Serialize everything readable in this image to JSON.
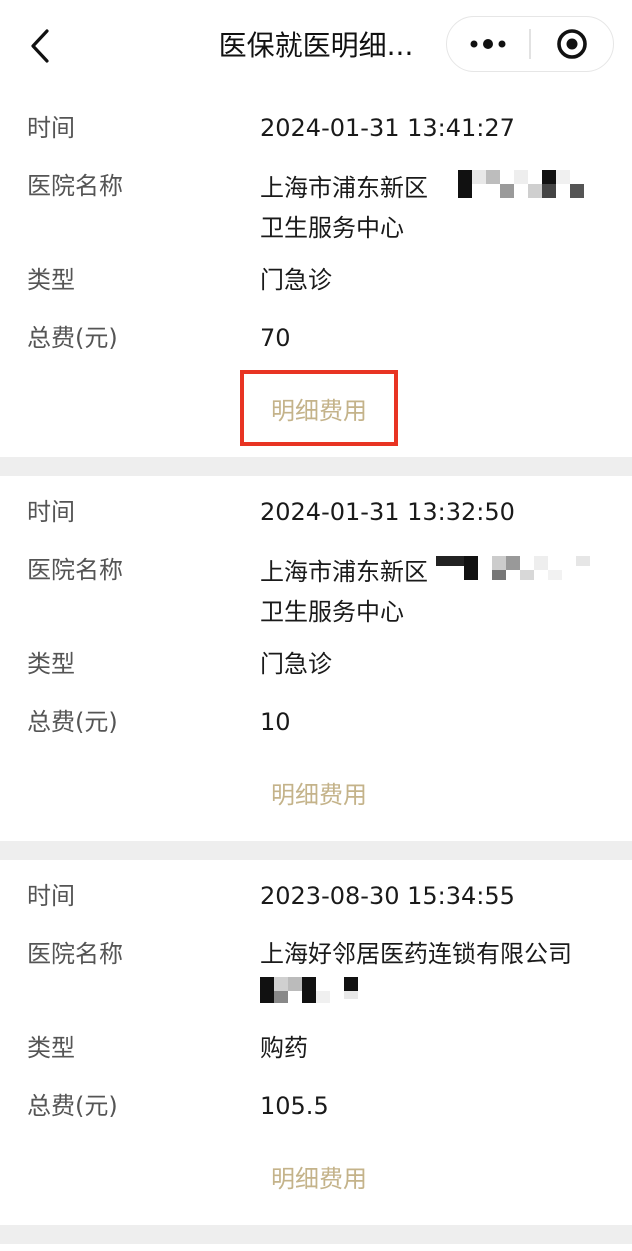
{
  "header": {
    "title": "医保就医明细...",
    "back_icon": "chevron-left-icon",
    "more_icon": "more-dots-icon",
    "close_icon": "target-circle-icon"
  },
  "labels": {
    "time": "时间",
    "hospital": "医院名称",
    "type": "类型",
    "total": "总费(元)"
  },
  "records": [
    {
      "time": "2024-01-31 13:41:27",
      "hospital_line1": "上海市浦东新区",
      "hospital_line2": "卫生服务中心",
      "type": "门急诊",
      "total": "70",
      "detail_label": "明细费用",
      "highlighted": true
    },
    {
      "time": "2024-01-31 13:32:50",
      "hospital_line1": "上海市浦东新区",
      "hospital_line2": "卫生服务中心",
      "type": "门急诊",
      "total": "10",
      "detail_label": "明细费用",
      "highlighted": false
    },
    {
      "time": "2023-08-30 15:34:55",
      "hospital_line1": "上海好邻居医药连锁有限公司",
      "hospital_line2": "",
      "type": "购药",
      "total": "105.5",
      "detail_label": "明细费用",
      "highlighted": false
    }
  ],
  "colors": {
    "accent_text": "#c4b38a",
    "highlight_border": "#e83423",
    "separator": "#eeeeee",
    "label": "#555555"
  }
}
